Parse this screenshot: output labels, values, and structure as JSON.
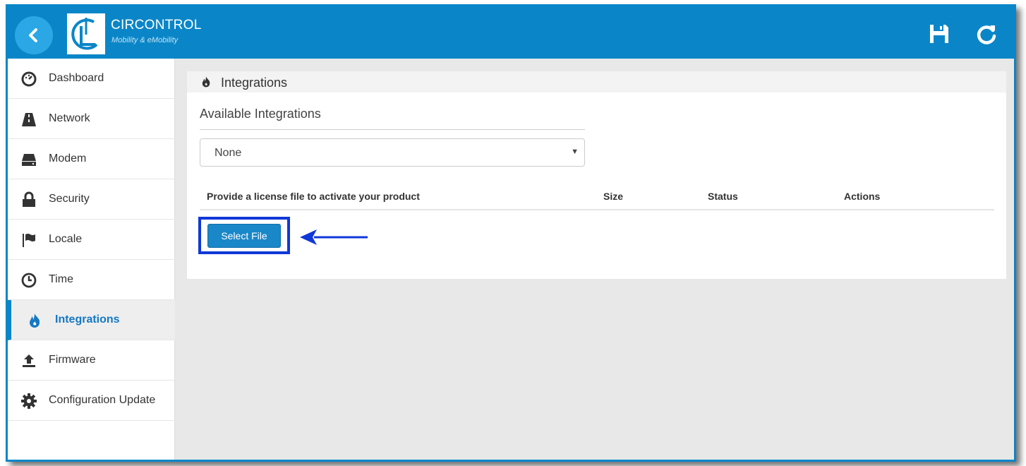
{
  "header": {
    "brand_name": "CIRCONTROL",
    "brand_tagline": "Mobility & eMobility",
    "icons": [
      "back-icon",
      "save-icon",
      "refresh-icon"
    ]
  },
  "sidebar": {
    "items": [
      {
        "label": "Dashboard",
        "icon": "dashboard-icon",
        "active": false
      },
      {
        "label": "Network",
        "icon": "road-icon",
        "active": false
      },
      {
        "label": "Modem",
        "icon": "hdd-icon",
        "active": false
      },
      {
        "label": "Security",
        "icon": "lock-icon",
        "active": false
      },
      {
        "label": "Locale",
        "icon": "flag-icon",
        "active": false
      },
      {
        "label": "Time",
        "icon": "clock-icon",
        "active": false
      },
      {
        "label": "Integrations",
        "icon": "fire-icon",
        "active": true
      },
      {
        "label": "Firmware",
        "icon": "upload-icon",
        "active": false
      },
      {
        "label": "Configuration Update",
        "icon": "gear-icon",
        "active": false
      }
    ]
  },
  "main": {
    "panel_title": "Integrations",
    "available_title": "Available Integrations",
    "select_value": "None",
    "table": {
      "headers": [
        "Provide a license file to activate your product",
        "Size",
        "Status",
        "Actions"
      ]
    },
    "select_file_label": "Select File"
  },
  "colors": {
    "brand_blue": "#0a86c8",
    "active_text": "#1578c2",
    "annotation_blue": "#1038d8"
  }
}
